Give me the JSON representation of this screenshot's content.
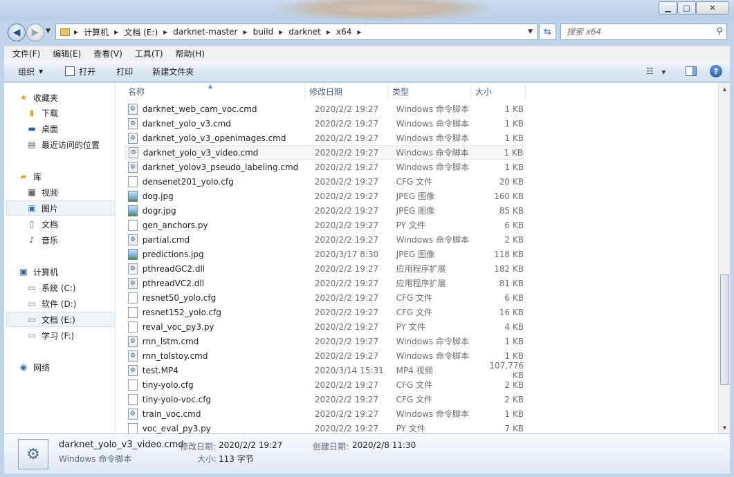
{
  "titlebar": {
    "min_icon": "minimize-icon",
    "max_icon": "maximize-icon",
    "close_icon": "close-icon"
  },
  "address": {
    "crumbs": [
      "计算机",
      "文档 (E:)",
      "darknet-master",
      "build",
      "darknet",
      "x64"
    ]
  },
  "search": {
    "placeholder": "搜索 x64"
  },
  "menu": [
    "文件(F)",
    "编辑(E)",
    "查看(V)",
    "工具(T)",
    "帮助(H)"
  ],
  "commands": {
    "organize": "组织",
    "open": "打开",
    "print": "打印",
    "new_folder": "新建文件夹"
  },
  "nav": {
    "favorites": "收藏夹",
    "downloads": "下载",
    "desktop": "桌面",
    "recent": "最近访问的位置",
    "libraries": "库",
    "videos": "视频",
    "pictures": "图片",
    "documents": "文档",
    "music": "音乐",
    "computer": "计算机",
    "drive_c": "系统 (C:)",
    "drive_d": "软件 (D:)",
    "drive_e": "文档 (E:)",
    "drive_f": "学习 (F:)",
    "network": "网络"
  },
  "columns": {
    "name": "名称",
    "date": "修改日期",
    "type": "类型",
    "size": "大小"
  },
  "files": [
    {
      "name": "darknet_web_cam_voc.cmd",
      "date": "2020/2/2 19:27",
      "type": "Windows 命令脚本",
      "size": "1 KB",
      "icon": "gear"
    },
    {
      "name": "darknet_yolo_v3.cmd",
      "date": "2020/2/2 19:27",
      "type": "Windows 命令脚本",
      "size": "1 KB",
      "icon": "gear"
    },
    {
      "name": "darknet_yolo_v3_openimages.cmd",
      "date": "2020/2/2 19:27",
      "type": "Windows 命令脚本",
      "size": "1 KB",
      "icon": "gear"
    },
    {
      "name": "darknet_yolo_v3_video.cmd",
      "date": "2020/2/2 19:27",
      "type": "Windows 命令脚本",
      "size": "1 KB",
      "icon": "gear"
    },
    {
      "name": "darknet_yolov3_pseudo_labeling.cmd",
      "date": "2020/2/2 19:27",
      "type": "Windows 命令脚本",
      "size": "1 KB",
      "icon": "gear"
    },
    {
      "name": "densenet201_yolo.cfg",
      "date": "2020/2/2 19:27",
      "type": "CFG 文件",
      "size": "20 KB",
      "icon": "doc"
    },
    {
      "name": "dog.jpg",
      "date": "2020/2/2 19:27",
      "type": "JPEG 图像",
      "size": "160 KB",
      "icon": "img"
    },
    {
      "name": "dogr.jpg",
      "date": "2020/2/2 19:27",
      "type": "JPEG 图像",
      "size": "85 KB",
      "icon": "img"
    },
    {
      "name": "gen_anchors.py",
      "date": "2020/2/2 19:27",
      "type": "PY 文件",
      "size": "6 KB",
      "icon": "doc"
    },
    {
      "name": "partial.cmd",
      "date": "2020/2/2 19:27",
      "type": "Windows 命令脚本",
      "size": "2 KB",
      "icon": "gear"
    },
    {
      "name": "predictions.jpg",
      "date": "2020/3/17 8:30",
      "type": "JPEG 图像",
      "size": "118 KB",
      "icon": "img"
    },
    {
      "name": "pthreadGC2.dll",
      "date": "2020/2/2 19:27",
      "type": "应用程序扩展",
      "size": "182 KB",
      "icon": "gear"
    },
    {
      "name": "pthreadVC2.dll",
      "date": "2020/2/2 19:27",
      "type": "应用程序扩展",
      "size": "81 KB",
      "icon": "gear"
    },
    {
      "name": "resnet50_yolo.cfg",
      "date": "2020/2/2 19:27",
      "type": "CFG 文件",
      "size": "6 KB",
      "icon": "doc"
    },
    {
      "name": "resnet152_yolo.cfg",
      "date": "2020/2/2 19:27",
      "type": "CFG 文件",
      "size": "16 KB",
      "icon": "doc"
    },
    {
      "name": "reval_voc_py3.py",
      "date": "2020/2/2 19:27",
      "type": "PY 文件",
      "size": "4 KB",
      "icon": "doc"
    },
    {
      "name": "rnn_lstm.cmd",
      "date": "2020/2/2 19:27",
      "type": "Windows 命令脚本",
      "size": "1 KB",
      "icon": "gear"
    },
    {
      "name": "rnn_tolstoy.cmd",
      "date": "2020/2/2 19:27",
      "type": "Windows 命令脚本",
      "size": "1 KB",
      "icon": "gear"
    },
    {
      "name": "test.MP4",
      "date": "2020/3/14 15:31",
      "type": "MP4 视频",
      "size": "107,776 KB",
      "icon": "gear"
    },
    {
      "name": "tiny-yolo.cfg",
      "date": "2020/2/2 19:27",
      "type": "CFG 文件",
      "size": "2 KB",
      "icon": "doc"
    },
    {
      "name": "tiny-yolo-voc.cfg",
      "date": "2020/2/2 19:27",
      "type": "CFG 文件",
      "size": "2 KB",
      "icon": "doc"
    },
    {
      "name": "train_voc.cmd",
      "date": "2020/2/2 19:27",
      "type": "Windows 命令脚本",
      "size": "1 KB",
      "icon": "gear"
    },
    {
      "name": "voc_eval_py3.py",
      "date": "2020/2/2 19:27",
      "type": "PY 文件",
      "size": "7 KB",
      "icon": "doc"
    }
  ],
  "details": {
    "name": "darknet_yolo_v3_video.cmd",
    "type": "Windows 命令脚本",
    "modified_label": "修改日期:",
    "modified": "2020/2/2 19:27",
    "created_label": "创建日期:",
    "created": "2020/2/8 11:30",
    "size_label": "大小:",
    "size": "113 字节"
  }
}
